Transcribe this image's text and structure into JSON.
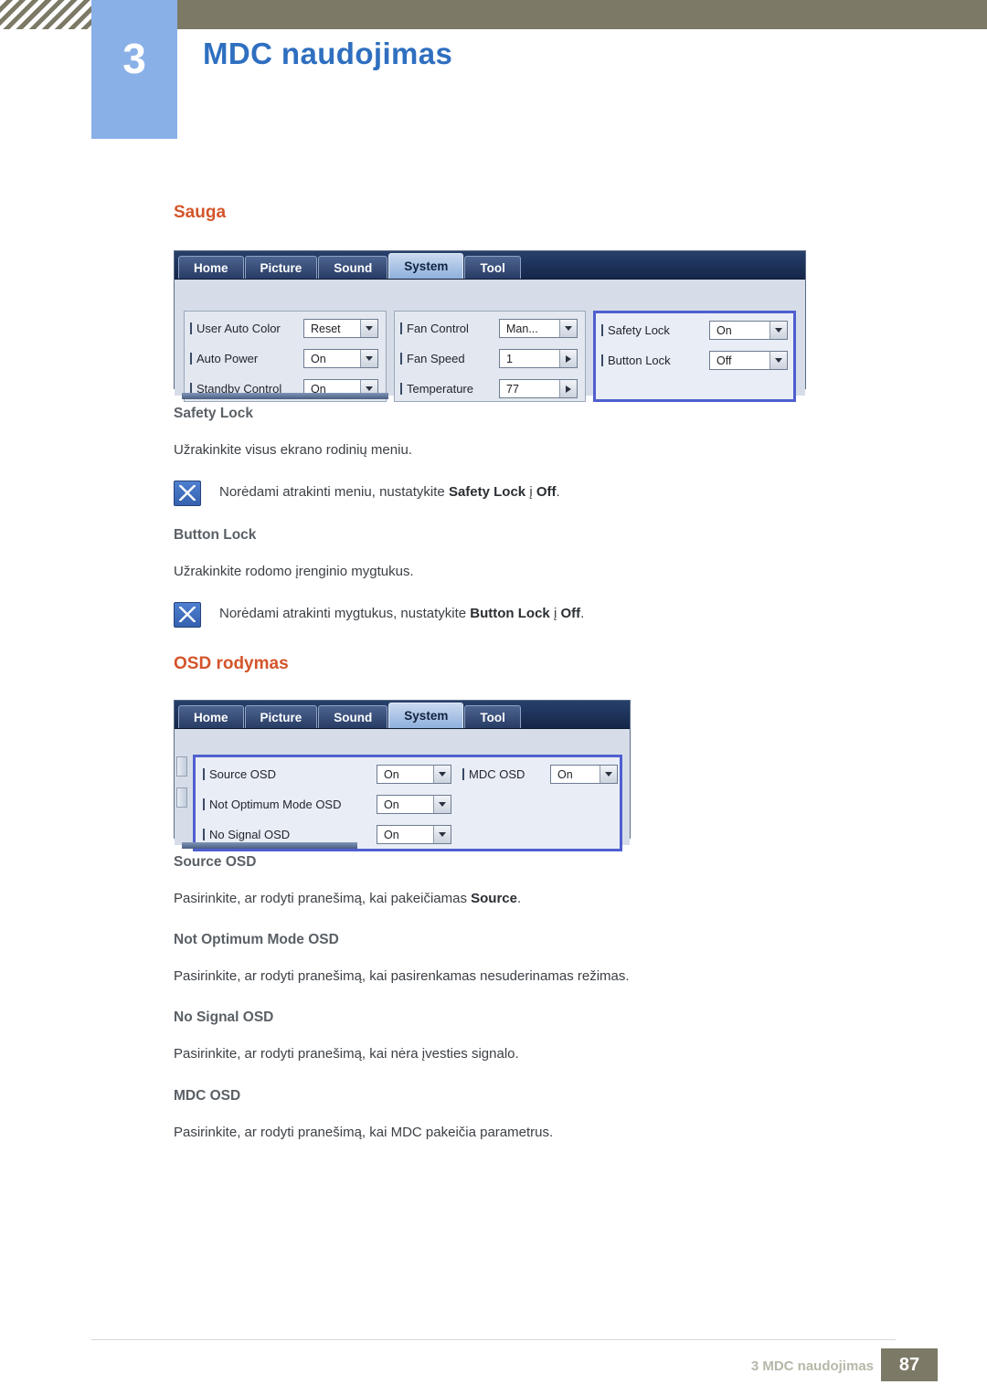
{
  "header": {
    "chapter_number": "3",
    "chapter_title": "MDC naudojimas"
  },
  "sections": {
    "sauga": {
      "title": "Sauga",
      "screenshot": {
        "tabs": [
          "Home",
          "Picture",
          "Sound",
          "System",
          "Tool"
        ],
        "active_tab": "System",
        "group1": [
          {
            "label": "User Auto Color",
            "value": "Reset",
            "control": "dropdown"
          },
          {
            "label": "Auto Power",
            "value": "On",
            "control": "dropdown"
          },
          {
            "label": "Standby Control",
            "value": "On",
            "control": "dropdown"
          }
        ],
        "group2": [
          {
            "label": "Fan Control",
            "value": "Man...",
            "control": "dropdown"
          },
          {
            "label": "Fan Speed",
            "value": "1",
            "control": "spinner"
          },
          {
            "label": "Temperature",
            "value": "77",
            "control": "spinner"
          }
        ],
        "group3": [
          {
            "label": "Safety Lock",
            "value": "On",
            "control": "dropdown"
          },
          {
            "label": "Button Lock",
            "value": "Off",
            "control": "dropdown"
          }
        ]
      },
      "items": [
        {
          "title": "Safety Lock",
          "body": "Užrakinkite visus ekrano rodinių meniu.",
          "note_prefix": "Norėdami atrakinti meniu, nustatykite ",
          "note_bold": "Safety Lock",
          "note_suffix": " į ",
          "note_bold2": "Off",
          "note_end": "."
        },
        {
          "title": "Button Lock",
          "body": "Užrakinkite rodomo įrenginio mygtukus.",
          "note_prefix": "Norėdami atrakinti mygtukus, nustatykite ",
          "note_bold": "Button Lock",
          "note_suffix": " į ",
          "note_bold2": "Off",
          "note_end": "."
        }
      ]
    },
    "osd": {
      "title": "OSD rodymas",
      "screenshot": {
        "tabs": [
          "Home",
          "Picture",
          "Sound",
          "System",
          "Tool"
        ],
        "active_tab": "System",
        "group1": [
          {
            "label": "Source OSD",
            "value": "On",
            "control": "dropdown"
          },
          {
            "label": "Not Optimum Mode OSD",
            "value": "On",
            "control": "dropdown"
          },
          {
            "label": "No Signal OSD",
            "value": "On",
            "control": "dropdown"
          }
        ],
        "group2": [
          {
            "label": "MDC OSD",
            "value": "On",
            "control": "dropdown"
          }
        ]
      },
      "items": [
        {
          "title": "Source OSD",
          "body_prefix": "Pasirinkite, ar rodyti pranešimą, kai pakeičiamas ",
          "body_bold": "Source",
          "body_end": "."
        },
        {
          "title": "Not Optimum Mode OSD",
          "body_prefix": "Pasirinkite, ar rodyti pranešimą, kai pasirenkamas nesuderinamas režimas.",
          "body_bold": "",
          "body_end": ""
        },
        {
          "title": "No Signal OSD",
          "body_prefix": "Pasirinkite, ar rodyti pranešimą, kai nėra įvesties signalo.",
          "body_bold": "",
          "body_end": ""
        },
        {
          "title": "MDC OSD",
          "body_prefix": "Pasirinkite, ar rodyti pranešimą, kai MDC pakeičia parametrus.",
          "body_bold": "",
          "body_end": ""
        }
      ]
    }
  },
  "footer": {
    "text": "3 MDC naudojimas",
    "page": "87"
  },
  "colors": {
    "header_bar": "#7c7a66",
    "chapter_box": "#8ab0e8",
    "chapter_title": "#2f6fc0",
    "section_title": "#d4552a",
    "sub_title": "#5a6066",
    "body_text": "#3c4045"
  }
}
